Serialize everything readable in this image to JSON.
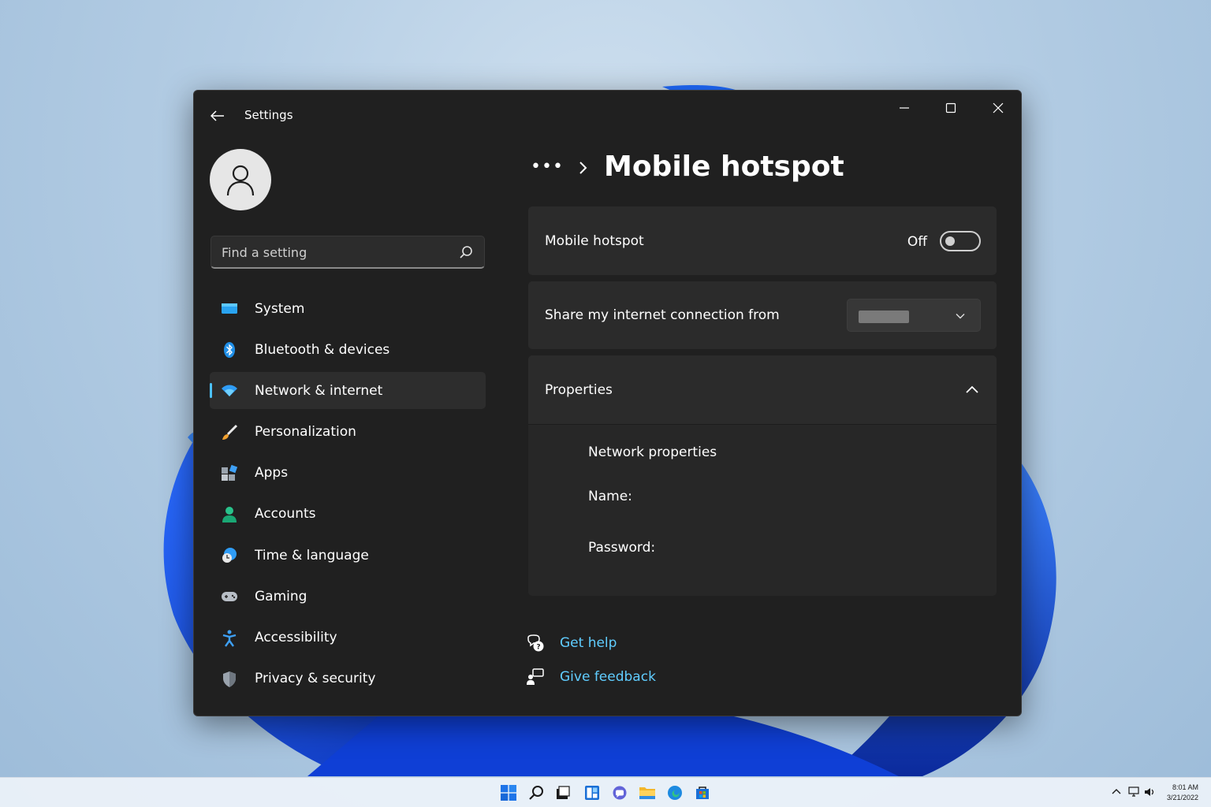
{
  "window": {
    "app_title": "Settings"
  },
  "sidebar": {
    "search_placeholder": "Find a setting",
    "items": [
      {
        "label": "System",
        "icon": "monitor-icon"
      },
      {
        "label": "Bluetooth & devices",
        "icon": "bluetooth-icon"
      },
      {
        "label": "Network & internet",
        "icon": "wifi-icon",
        "active": true
      },
      {
        "label": "Personalization",
        "icon": "brush-icon"
      },
      {
        "label": "Apps",
        "icon": "apps-icon"
      },
      {
        "label": "Accounts",
        "icon": "person-icon"
      },
      {
        "label": "Time & language",
        "icon": "clock-globe-icon"
      },
      {
        "label": "Gaming",
        "icon": "gamepad-icon"
      },
      {
        "label": "Accessibility",
        "icon": "accessibility-icon"
      },
      {
        "label": "Privacy & security",
        "icon": "shield-icon"
      }
    ]
  },
  "main": {
    "breadcrumb_overflow": "•••",
    "title": "Mobile hotspot",
    "hotspot_card": {
      "label": "Mobile hotspot",
      "state": "Off",
      "toggle_on": false
    },
    "share_card": {
      "label": "Share my internet connection from"
    },
    "properties_card": {
      "label": "Properties",
      "expanded": true,
      "network_properties": "Network properties",
      "name_label": "Name:",
      "password_label": "Password:"
    },
    "links": {
      "help": "Get help",
      "feedback": "Give feedback"
    }
  },
  "taskbar": {
    "time": "8:01 AM",
    "date": "3/21/2022",
    "apps": [
      "windows-start-icon",
      "search-icon",
      "task-view-icon",
      "widgets-icon",
      "teams-chat-icon",
      "file-explorer-icon",
      "edge-icon",
      "store-icon"
    ]
  },
  "colors": {
    "accent": "#4cc2ff",
    "link": "#60cdff",
    "window_bg": "#202020",
    "card_bg": "#2b2b2b"
  }
}
